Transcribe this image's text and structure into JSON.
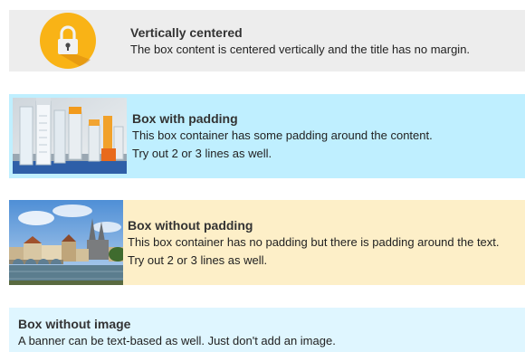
{
  "banners": [
    {
      "title": "Vertically centered",
      "lines": [
        "The box content is centered vertically and the title has no margin."
      ],
      "icon": "lock-icon",
      "background": "#ededed",
      "accent": "#f9b316"
    },
    {
      "title": "Box with padding",
      "lines": [
        "This box container has some padding around the content.",
        "Try out 2 or 3 lines as well."
      ],
      "image": "lab-test-tubes-image",
      "background": "#bfefff"
    },
    {
      "title": "Box without padding",
      "lines": [
        "This box container has no padding but there is padding around the text.",
        "Try out 2 or 3 lines as well."
      ],
      "image": "city-riverside-image",
      "background": "#fdefc8"
    },
    {
      "title": "Box without image",
      "lines": [
        "A banner can be text-based as well. Just don't add an image."
      ],
      "background": "#dff6ff"
    }
  ]
}
